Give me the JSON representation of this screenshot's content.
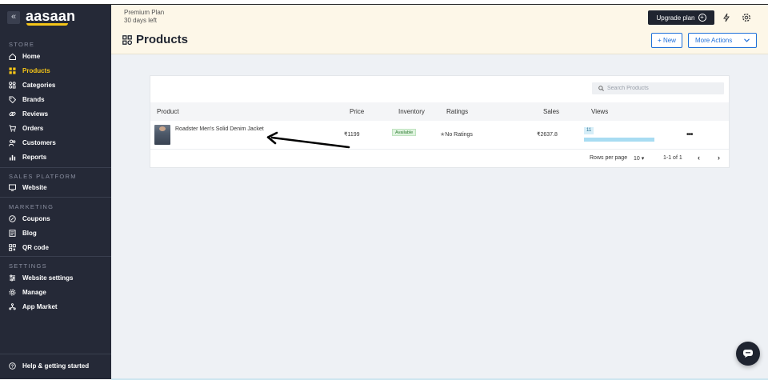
{
  "brand": {
    "name": "aasaan",
    "accent": "#f5c518"
  },
  "sidebar": {
    "collapse_glyph": "«",
    "sections": [
      {
        "title": "STORE",
        "items": [
          {
            "label": "Home",
            "icon": "home-icon",
            "active": false
          },
          {
            "label": "Products",
            "icon": "grid-icon",
            "active": true
          },
          {
            "label": "Categories",
            "icon": "categories-icon",
            "active": false
          },
          {
            "label": "Brands",
            "icon": "tag-icon",
            "active": false
          },
          {
            "label": "Reviews",
            "icon": "link-icon",
            "active": false
          },
          {
            "label": "Orders",
            "icon": "cart-icon",
            "active": false
          },
          {
            "label": "Customers",
            "icon": "customers-icon",
            "active": false
          },
          {
            "label": "Reports",
            "icon": "bar-chart-icon",
            "active": false
          }
        ]
      },
      {
        "title": "SALES PLATFORM",
        "items": [
          {
            "label": "Website",
            "icon": "monitor-icon",
            "active": false
          }
        ]
      },
      {
        "title": "MARKETING",
        "items": [
          {
            "label": "Coupons",
            "icon": "percent-icon",
            "active": false
          },
          {
            "label": "Blog",
            "icon": "blog-icon",
            "active": false
          },
          {
            "label": "QR code",
            "icon": "qr-icon",
            "active": false
          }
        ]
      },
      {
        "title": "SETTINGS",
        "items": [
          {
            "label": "Website settings",
            "icon": "settings-icon",
            "active": false
          },
          {
            "label": "Manage",
            "icon": "gear-icon",
            "active": false
          },
          {
            "label": "App Market",
            "icon": "app-market-icon",
            "active": false
          }
        ]
      }
    ],
    "help_label": "Help & getting started"
  },
  "header": {
    "plan_name": "Premium Plan",
    "plan_days": "30 days left",
    "page_title": "Products",
    "upgrade_label": "Upgrade plan",
    "new_label": "+ New",
    "more_actions_label": "More Actions"
  },
  "products": {
    "search_placeholder": "Search Products",
    "columns": [
      "Product",
      "Price",
      "Inventory",
      "Ratings",
      "Sales",
      "Views"
    ],
    "rows": [
      {
        "name": "Roadster Men's Solid Denim Jacket",
        "price": "₹1199",
        "inventory": "Available",
        "ratings": "No Ratings",
        "sales": "₹2637.8",
        "views": "11",
        "views_fill": 1.0
      }
    ],
    "pager": {
      "rows_per_page_label": "Rows per page",
      "rows_per_page_value": "10",
      "range": "1-1 of 1"
    }
  }
}
